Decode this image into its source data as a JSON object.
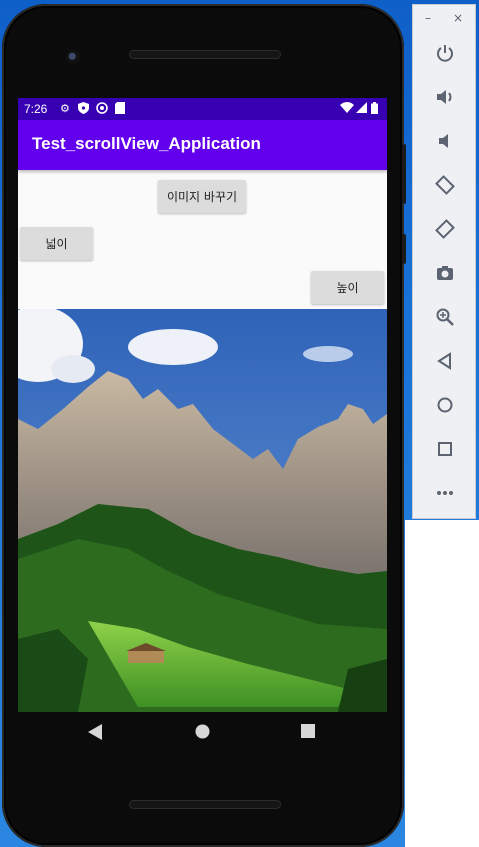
{
  "status_bar": {
    "time": "7:26"
  },
  "app": {
    "title": "Test_scrollView_Application"
  },
  "buttons": {
    "change_image": "이미지 바꾸기",
    "width": "넓이",
    "height": "높이"
  },
  "image": {
    "subject": "mountain-landscape-image"
  },
  "nav": {
    "back": "back-icon",
    "home": "home-icon",
    "recents": "recents-icon"
  },
  "emulator": {
    "minimize": "–",
    "close": "×",
    "tools": [
      "power-icon",
      "volume-up-icon",
      "volume-down-icon",
      "rotate-left-icon",
      "rotate-right-icon",
      "camera-icon",
      "zoom-icon",
      "back-icon",
      "home-icon",
      "overview-icon",
      "more-icon"
    ]
  },
  "colors": {
    "status": "#3700b3",
    "appbar": "#6200ee"
  }
}
